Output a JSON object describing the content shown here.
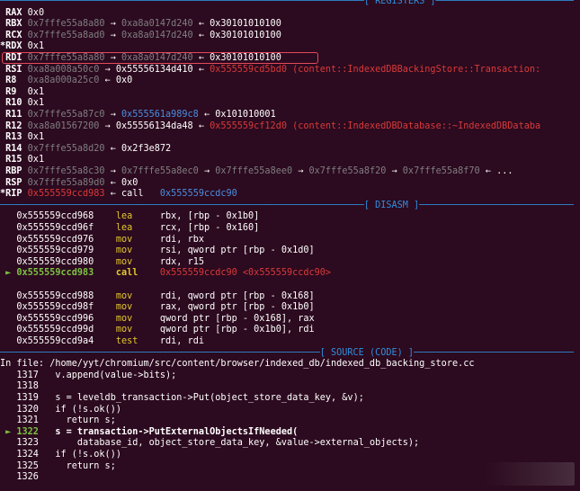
{
  "headers": {
    "registers": "[ REGISTERS ]",
    "disasm": "[ DISASM ]",
    "source": "[ SOURCE (CODE) ]"
  },
  "registers": [
    {
      "mark": " ",
      "name": "RAX",
      "segments": [
        {
          "t": "0x0",
          "c": "w"
        }
      ]
    },
    {
      "mark": " ",
      "name": "RBX",
      "segments": [
        {
          "t": "0x7fffe55a8a80",
          "c": "g"
        },
        {
          "t": " → ",
          "c": "w"
        },
        {
          "t": "0xa8a0147d240",
          "c": "g"
        },
        {
          "t": " ← ",
          "c": "w"
        },
        {
          "t": "0x30101010100",
          "c": "w"
        }
      ]
    },
    {
      "mark": " ",
      "name": "RCX",
      "segments": [
        {
          "t": "0x7fffe55a8ad0",
          "c": "g"
        },
        {
          "t": " → ",
          "c": "w"
        },
        {
          "t": "0xa8a0147d240",
          "c": "g"
        },
        {
          "t": " ← ",
          "c": "w"
        },
        {
          "t": "0x30101010100",
          "c": "w"
        }
      ]
    },
    {
      "mark": "*",
      "name": "RDX",
      "segments": [
        {
          "t": "0x1",
          "c": "w"
        }
      ]
    },
    {
      "mark": " ",
      "name": "RDI",
      "segments": [
        {
          "t": "0x7fffe55a8a80",
          "c": "g"
        },
        {
          "t": " → ",
          "c": "w"
        },
        {
          "t": "0xa8a0147d240",
          "c": "g"
        },
        {
          "t": " ← ",
          "c": "w"
        },
        {
          "t": "0x30101010100",
          "c": "w"
        }
      ]
    },
    {
      "mark": " ",
      "name": "RSI",
      "segments": [
        {
          "t": "0xa8a008a50c0",
          "c": "g"
        },
        {
          "t": " → ",
          "c": "w"
        },
        {
          "t": "0x55556134d410",
          "c": "w"
        },
        {
          "t": " ← ",
          "c": "w"
        },
        {
          "t": "0x555559cd5bd0 (content::IndexedDBBackingStore::Transaction:",
          "c": "r"
        }
      ]
    },
    {
      "mark": " ",
      "name": "R8",
      "segments": [
        {
          "t": "0xa8a000a25c0",
          "c": "g"
        },
        {
          "t": " ← ",
          "c": "w"
        },
        {
          "t": "0x0",
          "c": "w"
        }
      ]
    },
    {
      "mark": " ",
      "name": "R9",
      "segments": [
        {
          "t": "0x1",
          "c": "w"
        }
      ]
    },
    {
      "mark": " ",
      "name": "R10",
      "segments": [
        {
          "t": "0x1",
          "c": "w"
        }
      ]
    },
    {
      "mark": " ",
      "name": "R11",
      "segments": [
        {
          "t": "0x7fffe55a87c0",
          "c": "g"
        },
        {
          "t": " → ",
          "c": "w"
        },
        {
          "t": "0x555561a989c8",
          "c": "b"
        },
        {
          "t": " ← ",
          "c": "w"
        },
        {
          "t": "0x101010001",
          "c": "w"
        }
      ]
    },
    {
      "mark": " ",
      "name": "R12",
      "segments": [
        {
          "t": "0xa8a01567200",
          "c": "g"
        },
        {
          "t": " → ",
          "c": "w"
        },
        {
          "t": "0x55556134da48",
          "c": "w"
        },
        {
          "t": " ← ",
          "c": "w"
        },
        {
          "t": "0x555559cf12d0 (content::IndexedDBDatabase::~IndexedDBDataba",
          "c": "r"
        }
      ]
    },
    {
      "mark": " ",
      "name": "R13",
      "segments": [
        {
          "t": "0x1",
          "c": "w"
        }
      ]
    },
    {
      "mark": " ",
      "name": "R14",
      "segments": [
        {
          "t": "0x7fffe55a8d20",
          "c": "g"
        },
        {
          "t": " ← ",
          "c": "w"
        },
        {
          "t": "0x2f3e872",
          "c": "w"
        }
      ]
    },
    {
      "mark": " ",
      "name": "R15",
      "segments": [
        {
          "t": "0x1",
          "c": "w"
        }
      ]
    },
    {
      "mark": " ",
      "name": "RBP",
      "segments": [
        {
          "t": "0x7fffe55a8c30",
          "c": "g"
        },
        {
          "t": " → ",
          "c": "w"
        },
        {
          "t": "0x7fffe55a8ec0",
          "c": "g"
        },
        {
          "t": " → ",
          "c": "w"
        },
        {
          "t": "0x7fffe55a8ee0",
          "c": "g"
        },
        {
          "t": " → ",
          "c": "w"
        },
        {
          "t": "0x7fffe55a8f20",
          "c": "g"
        },
        {
          "t": " → ",
          "c": "w"
        },
        {
          "t": "0x7fffe55a8f70",
          "c": "g"
        },
        {
          "t": " ← ...",
          "c": "w"
        }
      ]
    },
    {
      "mark": " ",
      "name": "RSP",
      "segments": [
        {
          "t": "0x7fffe55a89d0",
          "c": "g"
        },
        {
          "t": " ← ",
          "c": "w"
        },
        {
          "t": "0x0",
          "c": "w"
        }
      ]
    },
    {
      "mark": "*",
      "name": "RIP",
      "segments": [
        {
          "t": "0x555559ccd983",
          "c": "r"
        },
        {
          "t": " ← ",
          "c": "w"
        },
        {
          "t": "call",
          "c": "w"
        },
        {
          "t": "   0x555559ccdc90",
          "c": "b"
        }
      ]
    }
  ],
  "disasm": [
    {
      "cur": false,
      "addr": "0x555559ccd968",
      "op": "lea",
      "args": "rbx, [rbp - 0x1b0]"
    },
    {
      "cur": false,
      "addr": "0x555559ccd96f",
      "op": "lea",
      "args": "rcx, [rbp - 0x160]"
    },
    {
      "cur": false,
      "addr": "0x555559ccd976",
      "op": "mov",
      "args": "rdi, rbx"
    },
    {
      "cur": false,
      "addr": "0x555559ccd979",
      "op": "mov",
      "args": "rsi, qword ptr [rbp - 0x1d0]"
    },
    {
      "cur": false,
      "addr": "0x555559ccd980",
      "op": "mov",
      "args": "rdx, r15"
    },
    {
      "cur": true,
      "addr": "0x555559ccd983",
      "op": "call",
      "args": "0x555559ccdc90 <0x555559ccdc90>"
    },
    {
      "cur": false,
      "addr": "",
      "op": "",
      "args": ""
    },
    {
      "cur": false,
      "addr": "0x555559ccd988",
      "op": "mov",
      "args": "rdi, qword ptr [rbp - 0x168]"
    },
    {
      "cur": false,
      "addr": "0x555559ccd98f",
      "op": "mov",
      "args": "rax, qword ptr [rbp - 0x1b0]"
    },
    {
      "cur": false,
      "addr": "0x555559ccd996",
      "op": "mov",
      "args": "qword ptr [rbp - 0x168], rax"
    },
    {
      "cur": false,
      "addr": "0x555559ccd99d",
      "op": "mov",
      "args": "qword ptr [rbp - 0x1b0], rdi"
    },
    {
      "cur": false,
      "addr": "0x555559ccd9a4",
      "op": "test",
      "args": "rdi, rdi"
    }
  ],
  "source_file": "In file: /home/yyt/chromium/src/content/browser/indexed_db/indexed_db_backing_store.cc",
  "source": [
    {
      "cur": false,
      "num": "1317",
      "code": "  v.append(value->bits);"
    },
    {
      "cur": false,
      "num": "1318",
      "code": ""
    },
    {
      "cur": false,
      "num": "1319",
      "code": "  s = leveldb_transaction->Put(object_store_data_key, &v);"
    },
    {
      "cur": false,
      "num": "1320",
      "code": "  if (!s.ok())"
    },
    {
      "cur": false,
      "num": "1321",
      "code": "    return s;"
    },
    {
      "cur": true,
      "num": "1322",
      "code": "  s = transaction->PutExternalObjectsIfNeeded("
    },
    {
      "cur": false,
      "num": "1323",
      "code": "      database_id, object_store_data_key, &value->external_objects);"
    },
    {
      "cur": false,
      "num": "1324",
      "code": "  if (!s.ok())"
    },
    {
      "cur": false,
      "num": "1325",
      "code": "    return s;"
    },
    {
      "cur": false,
      "num": "1326",
      "code": ""
    }
  ],
  "colors": {
    "background": "#2c0a1f",
    "header": "#2f8fdd",
    "highlight_box": "#e34a5c",
    "current_marker": "#7dc242"
  }
}
